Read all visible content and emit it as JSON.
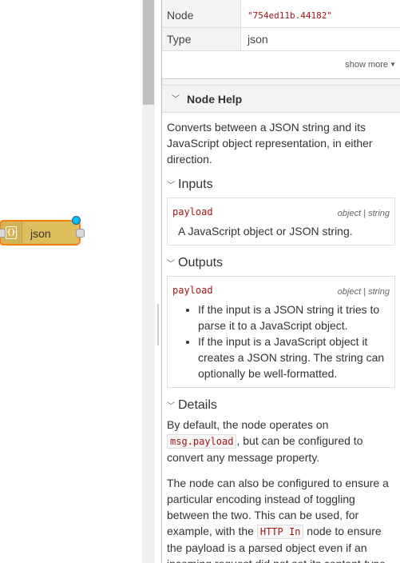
{
  "canvas": {
    "node": {
      "label": "json",
      "icon": "braces-icon",
      "color": "#debd5c",
      "selected_color": "#ff7f0e",
      "changed_color": "#00bcff"
    }
  },
  "info": {
    "rows": [
      {
        "key": "Node",
        "value": "\"754ed11b.44182\""
      },
      {
        "key": "Type",
        "value": "json"
      }
    ],
    "show_more": "show more"
  },
  "help": {
    "title": "Node Help",
    "intro": "Converts between a JSON string and its JavaScript object representation, in either direction.",
    "inputs_title": "Inputs",
    "input": {
      "name": "payload",
      "type": "object | string",
      "desc": "A JavaScript object or JSON string."
    },
    "outputs_title": "Outputs",
    "output": {
      "name": "payload",
      "type": "object | string",
      "items": [
        "If the input is a JSON string it tries to parse it to a JavaScript object.",
        "If the input is a JavaScript object it creates a JSON string. The string can optionally be well-formatted."
      ]
    },
    "details_title": "Details",
    "details_p1_a": "By default, the node operates on ",
    "details_p1_code": "msg.payload",
    "details_p1_b": ", but can be configured to convert any message property.",
    "details_p2_a": "The node can also be configured to ensure a particular encoding instead of toggling between the two. This can be used, for example, with the ",
    "details_p2_code": "HTTP In",
    "details_p2_b": " node to ensure the payload is a parsed object even if an incoming request did not set its content-type"
  }
}
